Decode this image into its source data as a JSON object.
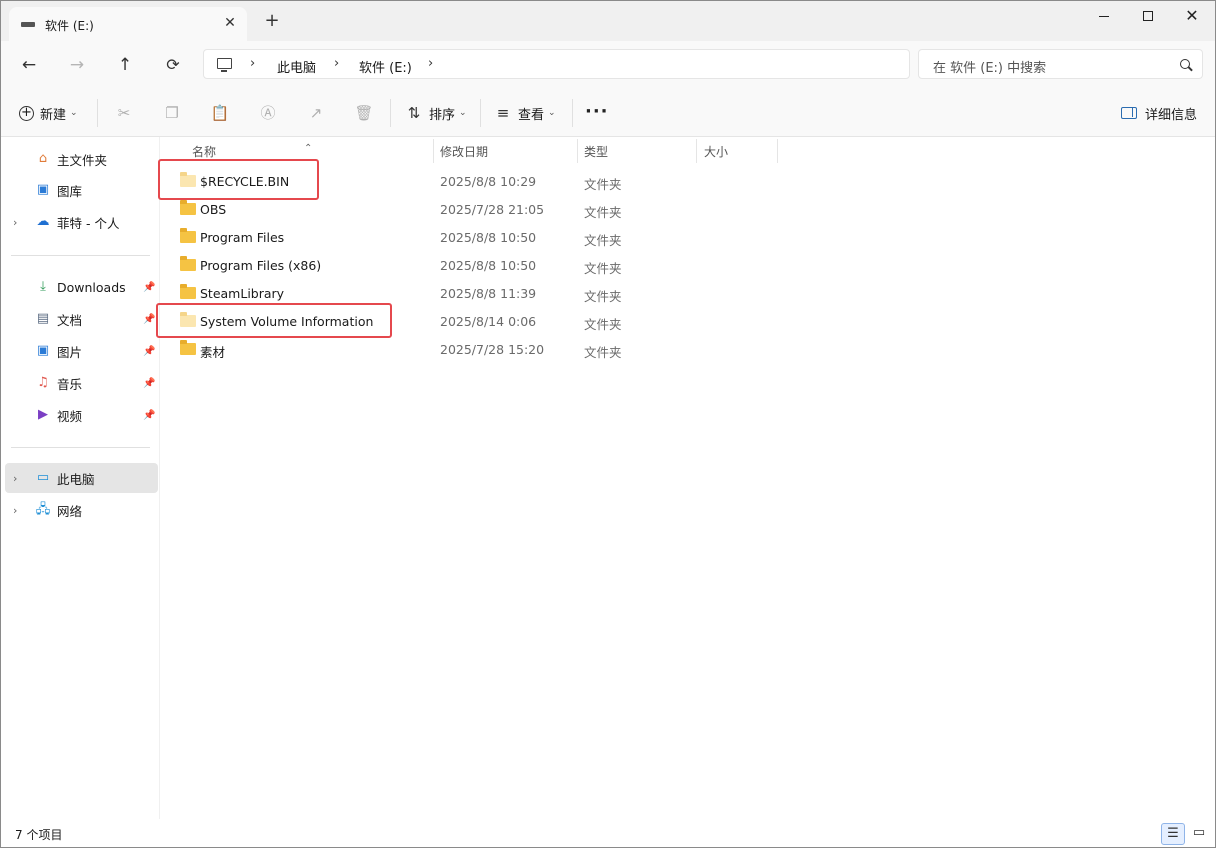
{
  "tab": {
    "title": "软件 (E:)",
    "close": "✕",
    "new_tab": "+"
  },
  "window_controls": {
    "close": "✕"
  },
  "nav": {
    "back": "←",
    "forward": "→",
    "up": "↑",
    "refresh": "⟳"
  },
  "address": {
    "separator": "›",
    "crumbs": [
      "此电脑",
      "软件 (E:)"
    ]
  },
  "search": {
    "placeholder": "在 软件 (E:) 中搜索"
  },
  "commandbar": {
    "new_label": "新建",
    "sort_label": "排序",
    "view_label": "查看",
    "more": "···",
    "details_label": "详细信息",
    "icons": [
      "cut-icon",
      "copy-icon",
      "paste-icon",
      "rename-icon",
      "share-icon",
      "delete-icon"
    ]
  },
  "sidebar": {
    "home": "主文件夹",
    "gallery": "图库",
    "onedrive": "菲特 - 个人",
    "quick": [
      {
        "label": "Downloads"
      },
      {
        "label": "文档"
      },
      {
        "label": "图片"
      },
      {
        "label": "音乐"
      },
      {
        "label": "视频"
      }
    ],
    "this_pc": "此电脑",
    "network": "网络"
  },
  "columns": {
    "name": "名称",
    "modified": "修改日期",
    "type": "类型",
    "size": "大小"
  },
  "files": [
    {
      "name": "$RECYCLE.BIN",
      "modified": "2025/8/8 10:29",
      "type": "文件夹",
      "hidden": true,
      "highlighted": true
    },
    {
      "name": "OBS",
      "modified": "2025/7/28 21:05",
      "type": "文件夹",
      "hidden": false,
      "highlighted": false
    },
    {
      "name": "Program Files",
      "modified": "2025/8/8 10:50",
      "type": "文件夹",
      "hidden": false,
      "highlighted": false
    },
    {
      "name": "Program Files (x86)",
      "modified": "2025/8/8 10:50",
      "type": "文件夹",
      "hidden": false,
      "highlighted": false
    },
    {
      "name": "SteamLibrary",
      "modified": "2025/8/8 11:39",
      "type": "文件夹",
      "hidden": false,
      "highlighted": false
    },
    {
      "name": "System Volume Information",
      "modified": "2025/8/14 0:06",
      "type": "文件夹",
      "hidden": true,
      "highlighted": true
    },
    {
      "name": "素材",
      "modified": "2025/7/28 15:20",
      "type": "文件夹",
      "hidden": false,
      "highlighted": false
    }
  ],
  "status": {
    "item_count": "7 个项目"
  },
  "colors": {
    "highlight": "#e5484d",
    "folder": "#f5c343",
    "selection": "#e5e5e5"
  }
}
